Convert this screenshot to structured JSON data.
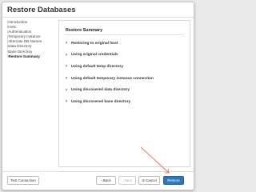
{
  "dialog": {
    "title": "Restore Databases"
  },
  "steps": [
    {
      "label": "Introduction",
      "active": false
    },
    {
      "label": "Host",
      "active": false
    },
    {
      "label": "Authentication",
      "active": false
    },
    {
      "label": "Temporary Instance",
      "active": false
    },
    {
      "label": "Alternate DB Names",
      "active": false
    },
    {
      "label": "Data Directory",
      "active": false
    },
    {
      "label": "Base Directory",
      "active": false
    },
    {
      "label": "Restore Summary",
      "active": true
    }
  ],
  "summary": {
    "title": "Restore Summary",
    "items": [
      "Restoring to original host",
      "Using original credentials",
      "Using default temp directory",
      "Using default temporary instance connection",
      "Using discovered data directory",
      "Using discovered base directory"
    ]
  },
  "footer": {
    "test_connection": "Test Connection",
    "back": "Back",
    "next": "Next",
    "cancel": "Cancel",
    "restore": "Restore",
    "back_icon": "chevron-left-icon",
    "next_icon": "chevron-right-icon",
    "cancel_icon": "cancel-circle-icon"
  },
  "colors": {
    "primary": "#2e77b8",
    "annotation_arrow": "#e8745a"
  }
}
